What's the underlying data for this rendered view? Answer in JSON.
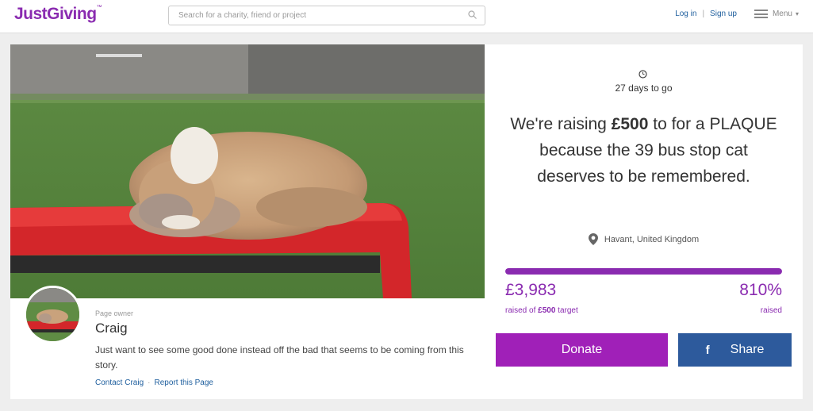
{
  "header": {
    "logo": "JustGiving",
    "logo_tm": "™",
    "search_placeholder": "Search for a charity, friend or project",
    "login": "Log in",
    "separator": "|",
    "signup": "Sign up",
    "menu": "Menu"
  },
  "owner": {
    "label": "Page owner",
    "name": "Craig",
    "description": "Just want to see some good done instead off the bad that seems to be coming from this story.",
    "contact": "Contact Craig",
    "dot": "·",
    "report": "Report this Page"
  },
  "campaign": {
    "days_to_go": "27 days to go",
    "headline_pre": "We're raising ",
    "headline_amount": "£500",
    "headline_post": " to for a PLAQUE because the 39 bus stop cat deserves to be remembered.",
    "location": "Havant, United Kingdom",
    "raised_amount": "£3,983",
    "raised_of": "raised of ",
    "target_amount": "£500",
    "target_word": " target",
    "percent": "810%",
    "percent_label": "raised",
    "progress_fraction": 1.0
  },
  "actions": {
    "donate": "Donate",
    "share_icon": "f",
    "share": "Share"
  },
  "colors": {
    "brand_purple": "#8a2bb0",
    "donate_button": "#a020b8",
    "share_button": "#2d5a9c",
    "link_blue": "#1f5f9e"
  },
  "icons": {
    "search": "search-icon",
    "menu": "hamburger-icon",
    "clock": "clock-icon",
    "location": "location-pin-icon",
    "facebook": "facebook-icon"
  }
}
